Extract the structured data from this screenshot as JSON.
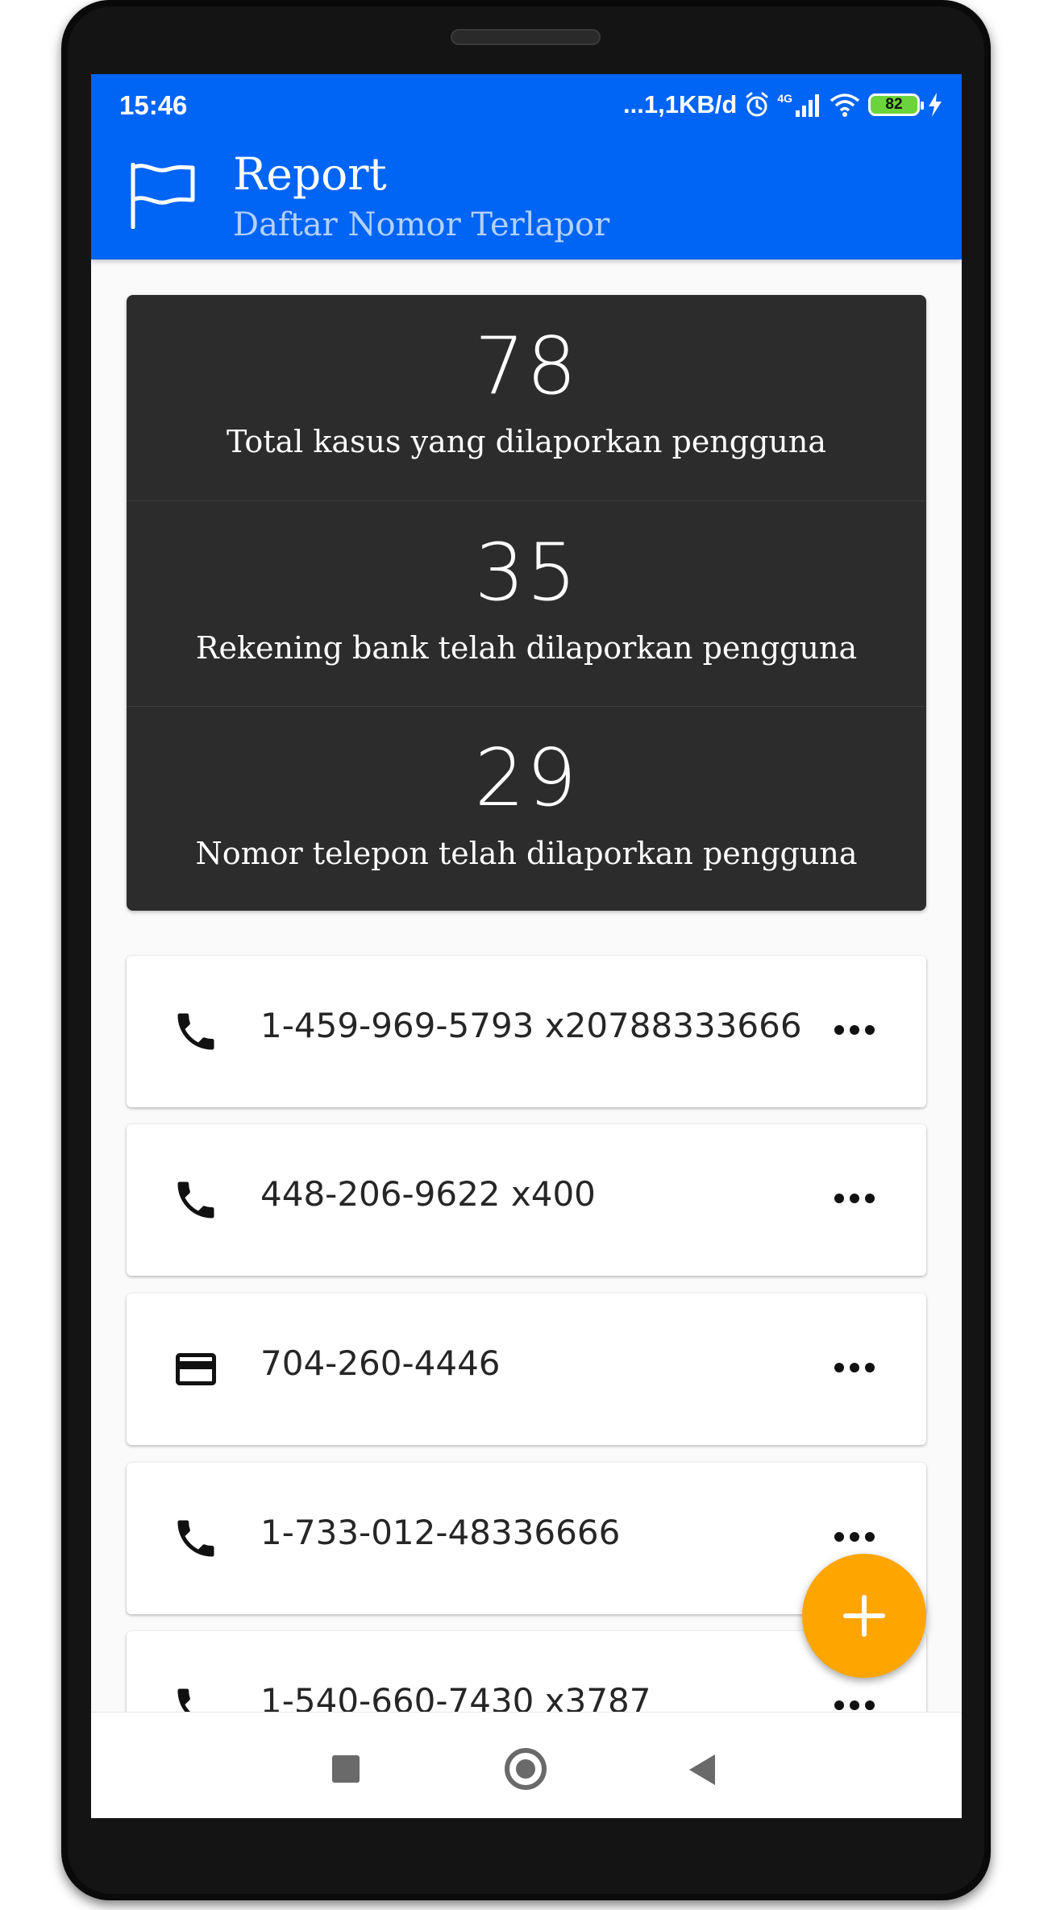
{
  "status_bar": {
    "time": "15:46",
    "network_speed": "...1,1KB/d",
    "network_type": "4G",
    "battery": "82",
    "icons": [
      "alarm-icon",
      "signal-icon",
      "wifi-icon",
      "battery-icon",
      "charging-icon"
    ]
  },
  "app_bar": {
    "title": "Report",
    "subtitle": "Daftar Nomor Terlapor",
    "icon": "flag-icon",
    "color": "#0064f5"
  },
  "stats": [
    {
      "value": "78",
      "label": "Total kasus yang dilaporkan pengguna"
    },
    {
      "value": "35",
      "label": "Rekening bank telah dilaporkan pengguna"
    },
    {
      "value": "29",
      "label": "Nomor telepon telah dilaporkan pengguna"
    }
  ],
  "reports": [
    {
      "type": "phone",
      "icon": "phone-icon",
      "number": "1-459-969-5793 x20788333666"
    },
    {
      "type": "phone",
      "icon": "phone-icon",
      "number": "448-206-9622 x400"
    },
    {
      "type": "bank",
      "icon": "credit-card-icon",
      "number": "704-260-4446"
    },
    {
      "type": "phone",
      "icon": "phone-icon",
      "number": "1-733-012-48336666"
    },
    {
      "type": "phone",
      "icon": "phone-icon",
      "number": "1-540-660-7430 x3787"
    }
  ],
  "fab": {
    "icon": "plus-icon",
    "color": "#ffa500"
  },
  "nav_bar": {
    "icons": [
      "recents-icon",
      "home-icon",
      "back-icon"
    ]
  }
}
